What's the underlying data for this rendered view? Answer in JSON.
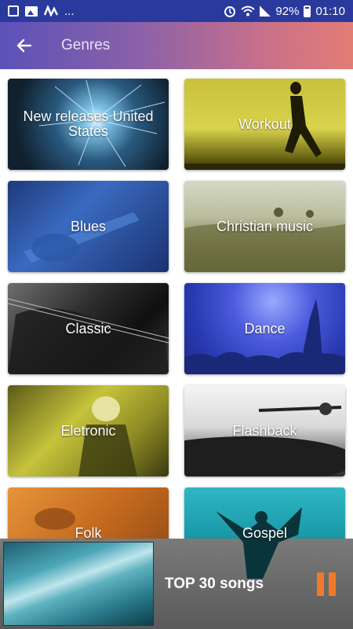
{
  "status_bar": {
    "overflow": "...",
    "battery": "92%",
    "time": "01:10"
  },
  "app_bar": {
    "title": "Genres",
    "back_icon": "arrow-left-icon"
  },
  "genres": [
    {
      "label": "New releases United States"
    },
    {
      "label": "Workout"
    },
    {
      "label": "Blues"
    },
    {
      "label": "Christian music"
    },
    {
      "label": "Classic"
    },
    {
      "label": "Dance"
    },
    {
      "label": "Eletronic"
    },
    {
      "label": "Flashback"
    },
    {
      "label": "Folk"
    },
    {
      "label": "Gospel"
    }
  ],
  "player": {
    "title": "TOP 30 songs",
    "pause_icon": "pause-icon",
    "accent": "#f07a2a"
  },
  "colors": {
    "status_bar": "#2a3a9c",
    "app_bar_start": "#5b52b8",
    "app_bar_end": "#e27d76"
  }
}
